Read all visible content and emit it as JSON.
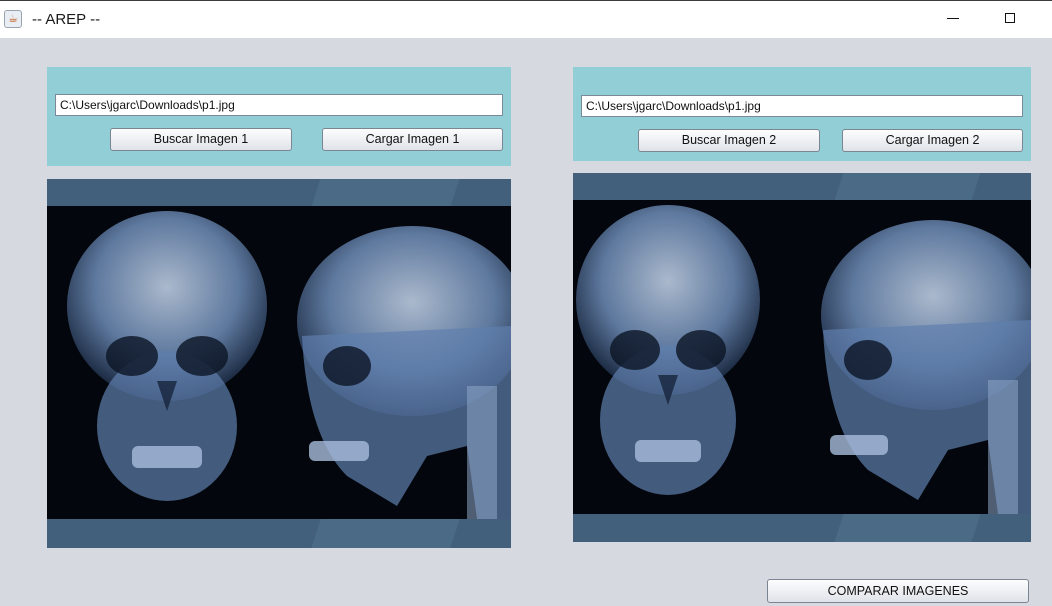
{
  "window": {
    "title": "-- AREP --"
  },
  "panel1": {
    "path_value": "C:\\Users\\jgarc\\Downloads\\p1.jpg",
    "browse_label": "Buscar Imagen 1",
    "load_label": "Cargar Imagen 1"
  },
  "panel2": {
    "path_value": "C:\\Users\\jgarc\\Downloads\\p1.jpg",
    "browse_label": "Buscar Imagen 2",
    "load_label": "Cargar Imagen 2"
  },
  "compare_label": "COMPARAR IMAGENES",
  "icons": {
    "app": "java-cup-icon",
    "minimize": "minimize-icon",
    "maximize": "maximize-icon"
  },
  "colors": {
    "panel": "#92ced5",
    "background": "#d6d9e0",
    "viewer_frame": "#3d5a75"
  }
}
